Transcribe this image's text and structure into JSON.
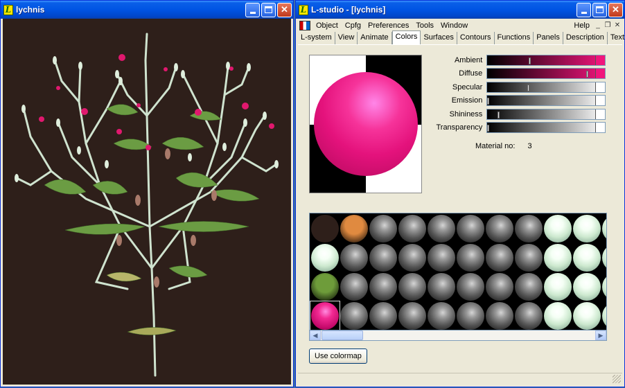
{
  "left_window": {
    "title": "lychnis",
    "logo": "L",
    "background": "#2e1f1a",
    "content": "3D rendered plant"
  },
  "right_window": {
    "logo": "L",
    "title": "L-studio - [lychnis]",
    "menu": [
      "Object",
      "Cpfg",
      "Preferences",
      "Tools",
      "Window"
    ],
    "help": "Help",
    "tabs": [
      "L-system",
      "View",
      "Animate",
      "Colors",
      "Surfaces",
      "Contours",
      "Functions",
      "Panels",
      "Description",
      "Text file"
    ],
    "active_tab": "Colors",
    "sliders": [
      {
        "label": "Ambient",
        "value": 0.36,
        "color": "#f0167c"
      },
      {
        "label": "Diffuse",
        "value": 0.86,
        "color": "#f0167c"
      },
      {
        "label": "Specular",
        "value": 0.35,
        "color": "#ffffff"
      },
      {
        "label": "Emission",
        "value": 0.0,
        "color": "#ffffff"
      },
      {
        "label": "Shininess",
        "value": 0.09,
        "color": "#ffffff"
      },
      {
        "label": "Transparency",
        "value": 0.0,
        "color": "#ffffff"
      }
    ],
    "material_label": "Material no:",
    "material_no": "3",
    "colormap_button": "Use colormap",
    "material_colors": {
      "dark_brown": "#2e1f1a",
      "orange": "#e08a40",
      "gray": "#888888",
      "pale_green": "#dff2df",
      "olive_green": "#6e9c3a",
      "magenta": "#f0167c"
    }
  }
}
